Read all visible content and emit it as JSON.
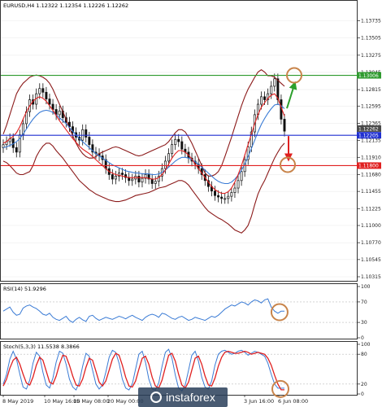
{
  "header": {
    "main": "EURUSD,H4  1.12322 1.12354 1.12226 1.12262",
    "rsi": "RSI(14) 51.9296",
    "stoch": "Stoch(5,3,3) 11.5538 8.3866"
  },
  "watermark": "instaforex",
  "colors": {
    "candle_up": "#ffffff",
    "candle_down": "#111111",
    "bollinger": "#8b1a1a",
    "ma_red": "#e02020",
    "ma_blue": "#3a7bd5",
    "resistance": "#2e9a2e",
    "pivot": "#1f2fd0",
    "support": "#e02020",
    "arrow_up": "#2ca02c",
    "arrow_down": "#e02020",
    "circle": "#c8844a",
    "rsi_line": "#3a7bd5",
    "stoch_main": "#3a7bd5",
    "stoch_signal": "#e02020"
  },
  "chart_data": [
    {
      "type": "candlestick",
      "title": "EURUSD,H4",
      "y_ticks": [
        "1.13735",
        "1.13505",
        "1.13275",
        "1.13045",
        "1.12815",
        "1.12595",
        "1.12365",
        "1.12135",
        "1.11910",
        "1.11680",
        "1.11455",
        "1.11225",
        "1.11000",
        "1.10770",
        "1.10545",
        "1.10315"
      ],
      "ylim": [
        1.10315,
        1.1386
      ],
      "x_ticks": [
        "8 May 2019",
        "10 May 16:00",
        "15 May 08:00",
        "20 May 00:00",
        "3 Jun 16:00",
        "6 Jun 08:00"
      ],
      "levels": [
        {
          "name": "resistance",
          "value": 1.13006,
          "label": "1.13006"
        },
        {
          "name": "current-price",
          "value": 1.12262,
          "label": "1.12262"
        },
        {
          "name": "pivot",
          "value": 1.12205,
          "label": "1.12205"
        },
        {
          "name": "support",
          "value": 1.118,
          "label": "1.11800"
        }
      ],
      "closes": [
        1.1208,
        1.1212,
        1.1216,
        1.1204,
        1.1198,
        1.1221,
        1.1236,
        1.1252,
        1.1268,
        1.1262,
        1.1276,
        1.1283,
        1.1278,
        1.1269,
        1.1262,
        1.1255,
        1.1248,
        1.1253,
        1.1244,
        1.1238,
        1.1232,
        1.1224,
        1.1218,
        1.1214,
        1.1228,
        1.1218,
        1.1208,
        1.1198,
        1.1196,
        1.1193,
        1.1188,
        1.1176,
        1.1168,
        1.1162,
        1.1166,
        1.117,
        1.1168,
        1.1164,
        1.116,
        1.1162,
        1.1166,
        1.1158,
        1.1163,
        1.1168,
        1.1162,
        1.1156,
        1.1159,
        1.1166,
        1.1176,
        1.1186,
        1.1196,
        1.1208,
        1.1215,
        1.1212,
        1.1202,
        1.1198,
        1.119,
        1.1186,
        1.1182,
        1.1176,
        1.1168,
        1.116,
        1.1152,
        1.1146,
        1.114,
        1.1138,
        1.1136,
        1.1136,
        1.1139,
        1.1144,
        1.115,
        1.116,
        1.1172,
        1.1188,
        1.1205,
        1.1225,
        1.1248,
        1.1262,
        1.1272,
        1.1268,
        1.1276,
        1.1286,
        1.1296,
        1.1268,
        1.1242,
        1.1226
      ],
      "upper_band": [
        1.1222,
        1.1234,
        1.1248,
        1.1262,
        1.1276,
        1.1284,
        1.129,
        1.1294,
        1.1298,
        1.13,
        1.1301,
        1.13,
        1.1298,
        1.1295,
        1.129,
        1.1282,
        1.1272,
        1.1262,
        1.1252,
        1.1242,
        1.123,
        1.122,
        1.121,
        1.1202,
        1.1196,
        1.1192,
        1.119,
        1.119,
        1.1192,
        1.1196,
        1.1198,
        1.12,
        1.1202,
        1.1204,
        1.1205,
        1.1204,
        1.1202,
        1.12,
        1.1198,
        1.1196,
        1.1194,
        1.1193,
        1.1194,
        1.1196,
        1.1198,
        1.12,
        1.1202,
        1.1204,
        1.1206,
        1.1208,
        1.1212,
        1.1218,
        1.1224,
        1.1228,
        1.1228,
        1.1225,
        1.1218,
        1.121,
        1.12,
        1.119,
        1.118,
        1.117,
        1.1166,
        1.1166,
        1.1168,
        1.1172,
        1.118,
        1.1192,
        1.1205,
        1.1218,
        1.1232,
        1.1246,
        1.126,
        1.1272,
        1.1282,
        1.129,
        1.1298,
        1.1305,
        1.1308,
        1.1305,
        1.13,
        1.13,
        1.1298,
        1.1294,
        1.129,
        1.1286
      ],
      "lower_band": [
        1.1186,
        1.1184,
        1.118,
        1.1175,
        1.117,
        1.1168,
        1.1168,
        1.117,
        1.1172,
        1.118,
        1.1192,
        1.12,
        1.1206,
        1.121,
        1.121,
        1.1206,
        1.12,
        1.1195,
        1.119,
        1.1184,
        1.1178,
        1.1172,
        1.1166,
        1.116,
        1.1156,
        1.1152,
        1.1148,
        1.1145,
        1.1142,
        1.114,
        1.1138,
        1.1136,
        1.1134,
        1.1133,
        1.1132,
        1.1132,
        1.1133,
        1.1134,
        1.1136,
        1.1138,
        1.114,
        1.1141,
        1.1142,
        1.1143,
        1.1144,
        1.1146,
        1.1148,
        1.115,
        1.1151,
        1.1152,
        1.1154,
        1.1156,
        1.1158,
        1.116,
        1.116,
        1.1158,
        1.1154,
        1.1148,
        1.1142,
        1.1136,
        1.113,
        1.1124,
        1.1119,
        1.1116,
        1.1113,
        1.111,
        1.1108,
        1.1105,
        1.1102,
        1.1098,
        1.1094,
        1.1092,
        1.109,
        1.1094,
        1.11,
        1.1112,
        1.1128,
        1.1142,
        1.1152,
        1.116,
        1.117,
        1.118,
        1.119,
        1.1198,
        1.1205,
        1.121
      ],
      "ma_red": [
        1.121,
        1.1212,
        1.1216,
        1.1219,
        1.1224,
        1.1232,
        1.1242,
        1.1252,
        1.126,
        1.1266,
        1.127,
        1.1272,
        1.127,
        1.1266,
        1.126,
        1.1254,
        1.1247,
        1.124,
        1.1234,
        1.1228,
        1.1222,
        1.1216,
        1.1211,
        1.1206,
        1.1202,
        1.1199,
        1.1196,
        1.1192,
        1.1188,
        1.1184,
        1.118,
        1.1176,
        1.1172,
        1.117,
        1.1168,
        1.1167,
        1.1166,
        1.1165,
        1.1164,
        1.1164,
        1.1164,
        1.1164,
        1.1164,
        1.1164,
        1.1163,
        1.1162,
        1.1162,
        1.1164,
        1.1168,
        1.1174,
        1.1182,
        1.119,
        1.1196,
        1.12,
        1.12,
        1.1198,
        1.1194,
        1.1189,
        1.1182,
        1.1176,
        1.117,
        1.1164,
        1.1158,
        1.1152,
        1.1148,
        1.1145,
        1.1143,
        1.1143,
        1.1145,
        1.115,
        1.1158,
        1.1168,
        1.118,
        1.1194,
        1.1208,
        1.1222,
        1.1236,
        1.1248,
        1.1258,
        1.1264,
        1.127,
        1.1274,
        1.1276,
        1.127,
        1.1258,
        1.1246
      ],
      "ma_blue": [
        1.1204,
        1.1205,
        1.1207,
        1.1209,
        1.1212,
        1.1216,
        1.1222,
        1.1229,
        1.1236,
        1.1242,
        1.1247,
        1.1251,
        1.1253,
        1.1254,
        1.1253,
        1.1251,
        1.1248,
        1.1244,
        1.124,
        1.1236,
        1.1231,
        1.1226,
        1.1221,
        1.1216,
        1.1212,
        1.1208,
        1.1204,
        1.12,
        1.1196,
        1.1193,
        1.119,
        1.1187,
        1.1184,
        1.1181,
        1.1179,
        1.1177,
        1.1175,
        1.1173,
        1.1172,
        1.1171,
        1.117,
        1.117,
        1.1169,
        1.1169,
        1.1169,
        1.1168,
        1.1168,
        1.1169,
        1.1171,
        1.1174,
        1.1178,
        1.1182,
        1.1186,
        1.1189,
        1.1191,
        1.1191,
        1.119,
        1.1188,
        1.1185,
        1.1182,
        1.1178,
        1.1174,
        1.117,
        1.1166,
        1.1162,
        1.1159,
        1.1157,
        1.1156,
        1.1156,
        1.1158,
        1.1162,
        1.1167,
        1.1174,
        1.1182,
        1.1192,
        1.1203,
        1.1214,
        1.1225,
        1.1235,
        1.1243,
        1.125,
        1.1256,
        1.1261,
        1.1262,
        1.126,
        1.1256
      ]
    },
    {
      "type": "line",
      "title": "RSI(14) 51.9296",
      "y_ticks": [
        "100",
        "70",
        "30",
        "0"
      ],
      "ylim": [
        0,
        100
      ],
      "series": [
        {
          "name": "RSI(14)",
          "values": [
            52,
            56,
            60,
            50,
            44,
            46,
            58,
            62,
            64,
            60,
            57,
            52,
            46,
            44,
            48,
            40,
            36,
            34,
            38,
            42,
            34,
            30,
            36,
            40,
            35,
            32,
            42,
            44,
            38,
            34,
            37,
            40,
            38,
            36,
            39,
            42,
            40,
            37,
            41,
            44,
            40,
            37,
            34,
            40,
            44,
            46,
            44,
            40,
            48,
            46,
            42,
            38,
            36,
            40,
            42,
            38,
            34,
            36,
            40,
            38,
            36,
            34,
            38,
            42,
            40,
            44,
            50,
            56,
            60,
            64,
            62,
            66,
            70,
            68,
            64,
            70,
            74,
            72,
            68,
            74,
            76,
            60,
            52,
            48,
            51.9,
            51.9
          ]
        }
      ]
    },
    {
      "type": "line",
      "title": "Stoch(5,3,3) 11.5538 8.3866",
      "y_ticks": [
        "100",
        "80",
        "20",
        "0"
      ],
      "ylim": [
        0,
        100
      ],
      "series": [
        {
          "name": "main",
          "values": [
            20,
            40,
            70,
            86,
            70,
            40,
            14,
            10,
            28,
            62,
            84,
            76,
            44,
            18,
            12,
            32,
            64,
            86,
            82,
            60,
            30,
            14,
            8,
            24,
            56,
            82,
            76,
            48,
            20,
            10,
            18,
            44,
            74,
            88,
            84,
            62,
            30,
            12,
            8,
            20,
            50,
            80,
            86,
            64,
            30,
            10,
            8,
            22,
            56,
            84,
            90,
            72,
            38,
            12,
            6,
            18,
            48,
            78,
            86,
            66,
            34,
            14,
            10,
            26,
            58,
            80,
            86,
            88,
            84,
            80,
            82,
            86,
            88,
            84,
            78,
            82,
            86,
            84,
            80,
            76,
            62,
            40,
            20,
            11.6,
            11.6,
            11.6
          ]
        },
        {
          "name": "signal",
          "values": [
            16,
            30,
            52,
            68,
            74,
            60,
            40,
            22,
            18,
            34,
            58,
            74,
            68,
            46,
            24,
            20,
            36,
            60,
            78,
            76,
            58,
            36,
            18,
            16,
            30,
            54,
            72,
            68,
            46,
            24,
            16,
            26,
            48,
            70,
            82,
            78,
            58,
            34,
            16,
            14,
            26,
            50,
            72,
            76,
            60,
            34,
            16,
            12,
            28,
            54,
            78,
            82,
            66,
            40,
            18,
            12,
            24,
            48,
            72,
            76,
            60,
            36,
            18,
            16,
            32,
            56,
            74,
            84,
            86,
            84,
            82,
            82,
            84,
            86,
            84,
            80,
            82,
            84,
            82,
            80,
            72,
            58,
            38,
            20,
            8.4,
            8.4
          ]
        }
      ]
    }
  ]
}
